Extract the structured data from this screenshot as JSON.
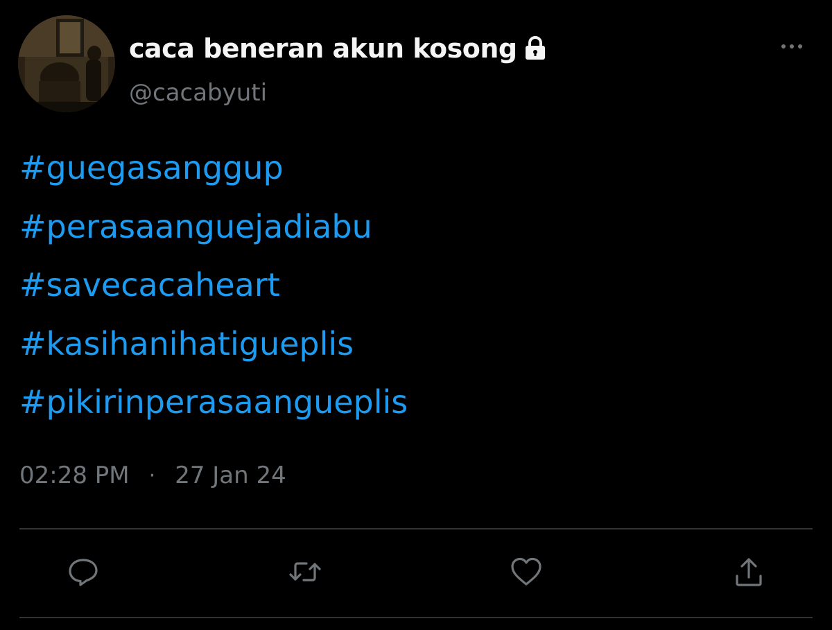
{
  "tweet": {
    "author": {
      "display_name": "caca beneran akun kosong",
      "handle": "@cacabyuti",
      "protected_icon": "lock-icon",
      "avatar_icon": "avatar-photo"
    },
    "more_icon": "more-dots-icon",
    "hashtags": [
      "#guegasanggup",
      "#perasaanguejadiabu",
      "#savecacaheart",
      "#kasihanihatigueplis",
      "#pikirinperasaangueplis"
    ],
    "time": "02:28 PM",
    "separator": "·",
    "date": "27 Jan 24",
    "actions": {
      "reply_icon": "reply-icon",
      "retweet_icon": "retweet-icon",
      "like_icon": "heart-icon",
      "share_icon": "share-icon"
    }
  },
  "colors": {
    "background": "#000000",
    "display_name": "#f5f5f5",
    "secondary_text": "#71767b",
    "hashtag": "#1d9bf0",
    "divider": "#2f3336",
    "icon": "#71767b"
  }
}
